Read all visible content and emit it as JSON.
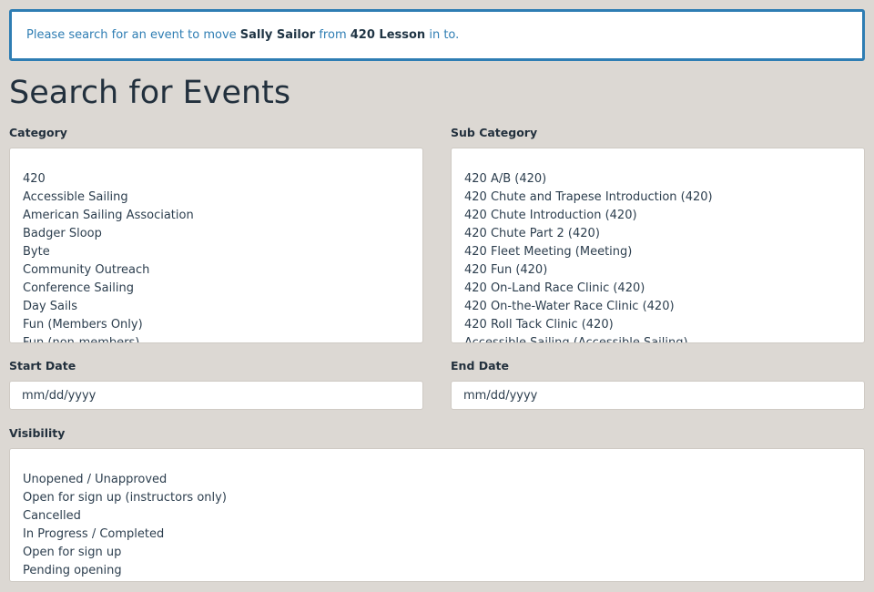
{
  "notice": {
    "prefix": "Please search for an event to move",
    "person": "Sally Sailor",
    "middle": "from",
    "event": "420 Lesson",
    "suffix": "in to."
  },
  "page_title": "Search for Events",
  "category": {
    "label": "Category",
    "options": [
      "420",
      "Accessible Sailing",
      "American Sailing Association",
      "Badger Sloop",
      "Byte",
      "Community Outreach",
      "Conference Sailing",
      "Day Sails",
      "Fun (Members Only)",
      "Fun (non-members)"
    ]
  },
  "subcategory": {
    "label": "Sub Category",
    "options": [
      "420 A/B (420)",
      "420 Chute and Trapese Introduction (420)",
      "420 Chute Introduction (420)",
      "420 Chute Part 2 (420)",
      "420 Fleet Meeting (Meeting)",
      "420 Fun (420)",
      "420 On-Land Race Clinic (420)",
      "420 On-the-Water Race Clinic (420)",
      "420 Roll Tack Clinic (420)",
      "Accessible Sailing (Accessible Sailing)"
    ]
  },
  "start_date": {
    "label": "Start Date",
    "placeholder": "mm/dd/yyyy"
  },
  "end_date": {
    "label": "End Date",
    "placeholder": "mm/dd/yyyy"
  },
  "visibility": {
    "label": "Visibility",
    "options": [
      "Unopened / Unapproved",
      "Open for sign up (instructors only)",
      "Cancelled",
      "In Progress / Completed",
      "Open for sign up",
      "Pending opening"
    ]
  }
}
